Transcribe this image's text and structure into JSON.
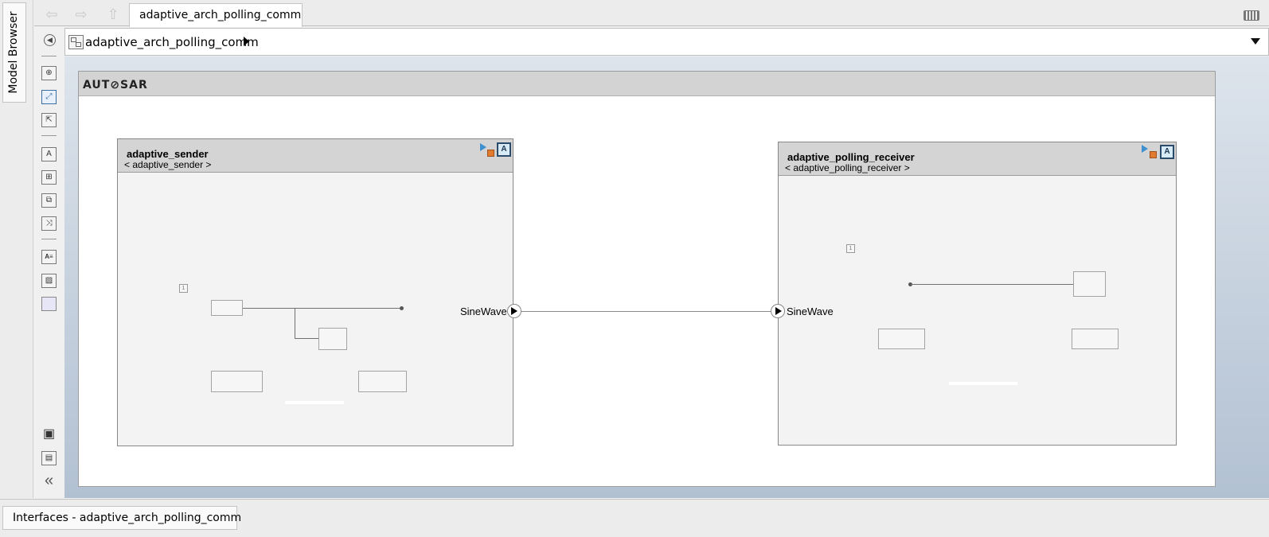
{
  "side_tab": {
    "label": "Model Browser"
  },
  "nav": {
    "back_icon": "back-arrow-icon",
    "forward_icon": "forward-arrow-icon",
    "up_icon": "up-arrow-icon"
  },
  "tabs": [
    {
      "label": "adaptive_arch_polling_comm"
    }
  ],
  "address": {
    "path": "adaptive_arch_polling_comm"
  },
  "autosar": {
    "logo_text": "AUT⊘SAR"
  },
  "components": [
    {
      "name": "adaptive_sender",
      "subtitle": "< adaptive_sender >",
      "port": "SineWave"
    },
    {
      "name": "adaptive_polling_receiver",
      "subtitle": "< adaptive_polling_receiver >",
      "port": "SineWave"
    }
  ],
  "bottom": {
    "tab_label": "Interfaces - adaptive_arch_polling_comm"
  },
  "collapse_glyph": "«",
  "tool_glyphs": {
    "text": "A",
    "annotation": "A≡"
  },
  "mini": {
    "num": "1"
  },
  "colors": {
    "autosar_accent": "#d32f2f",
    "badge": "#2a4b69",
    "canvas_top": "#dde4ec",
    "canvas_bottom": "#b2c1d2"
  }
}
